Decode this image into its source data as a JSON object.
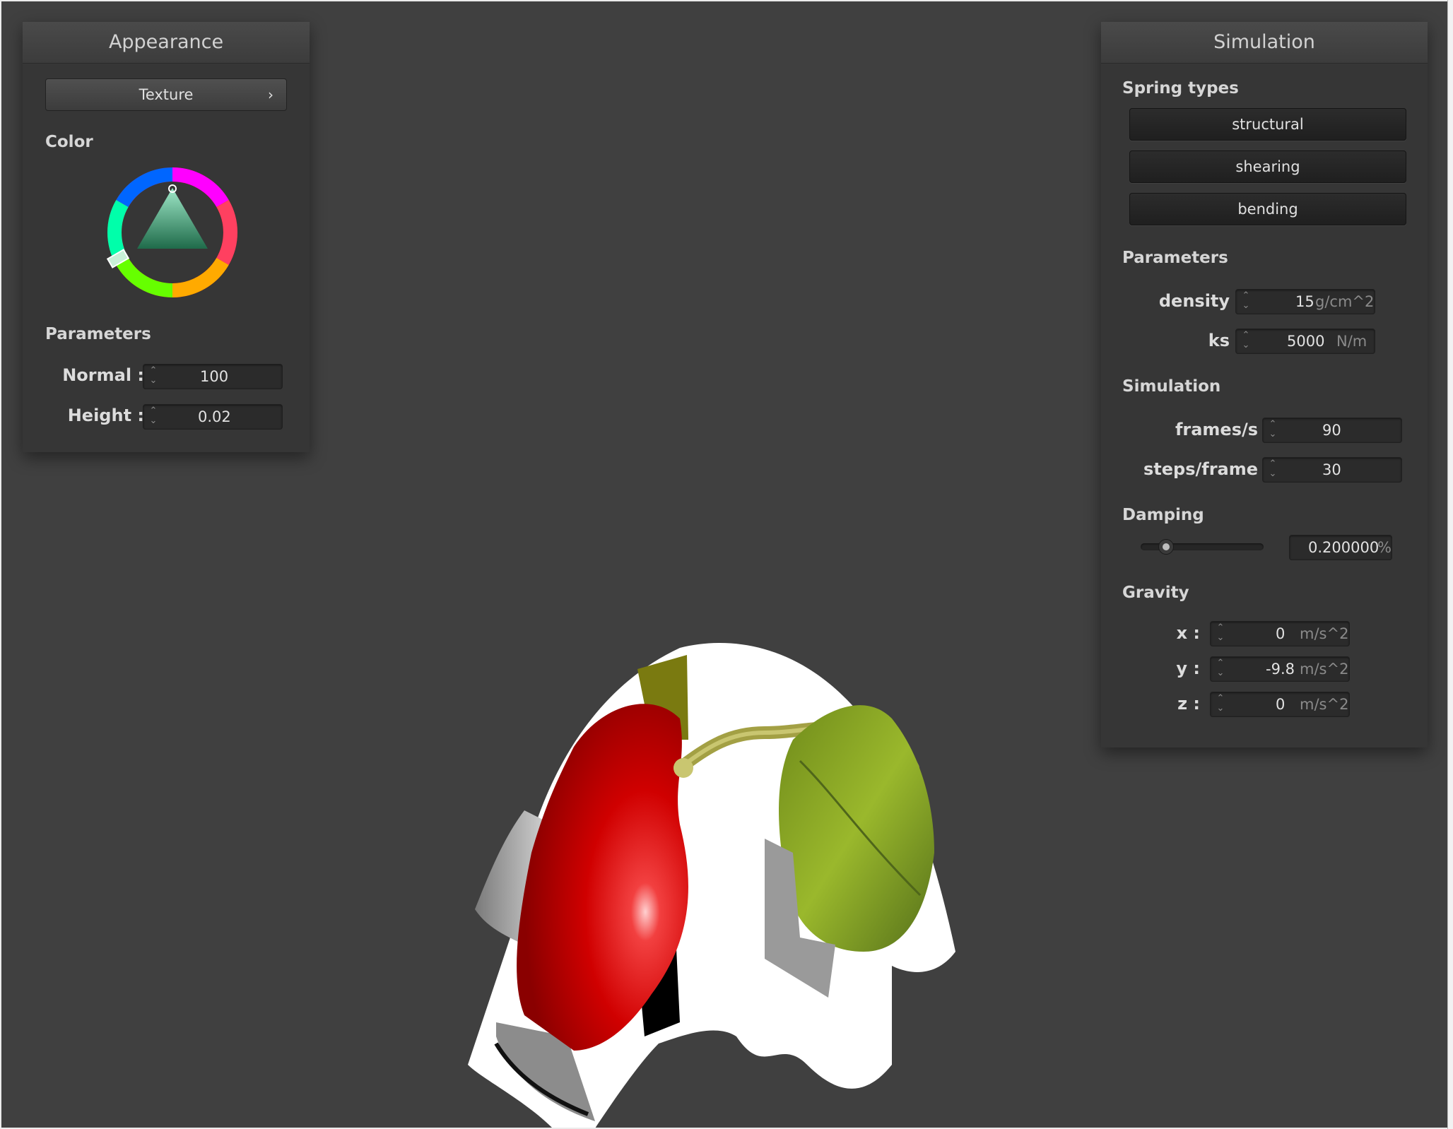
{
  "appearance": {
    "title": "Appearance",
    "texture_button": "Texture",
    "texture_chevron": "›",
    "color_title": "Color",
    "parameters_title": "Parameters",
    "normal_label": "Normal :",
    "normal_value": "100",
    "height_label": "Height :",
    "height_value": "0.02"
  },
  "simulation": {
    "title": "Simulation",
    "spring_types_title": "Spring types",
    "spring_types": [
      "structural",
      "shearing",
      "bending"
    ],
    "parameters_title": "Parameters",
    "density_label": "density :",
    "density_value": "15",
    "density_unit": "g/cm^2",
    "ks_label": "ks :",
    "ks_value": "5000",
    "ks_unit": "N/m",
    "simulation_title": "Simulation",
    "fps_label": "frames/s :",
    "fps_value": "90",
    "steps_label": "steps/frame :",
    "steps_value": "30",
    "damping_title": "Damping",
    "damping_value": "0.200000",
    "damping_unit": "%",
    "damping_fraction": 0.2,
    "gravity_title": "Gravity",
    "gx_label": "x :",
    "gx_value": "0",
    "gy_label": "y :",
    "gy_value": "-9.8",
    "gz_label": "z :",
    "gz_value": "0",
    "gravity_unit": "m/s^2"
  },
  "icons": {
    "spinner": "spinner-arrows-icon",
    "chevron": "chevron-right-icon",
    "color_wheel": "color-wheel-icon"
  },
  "colors": {
    "viewport_bg": "#404040",
    "panel_bg": "#363636",
    "cloth_texture_red": "#d00000",
    "cloth_texture_leaf": "#8fa826"
  }
}
